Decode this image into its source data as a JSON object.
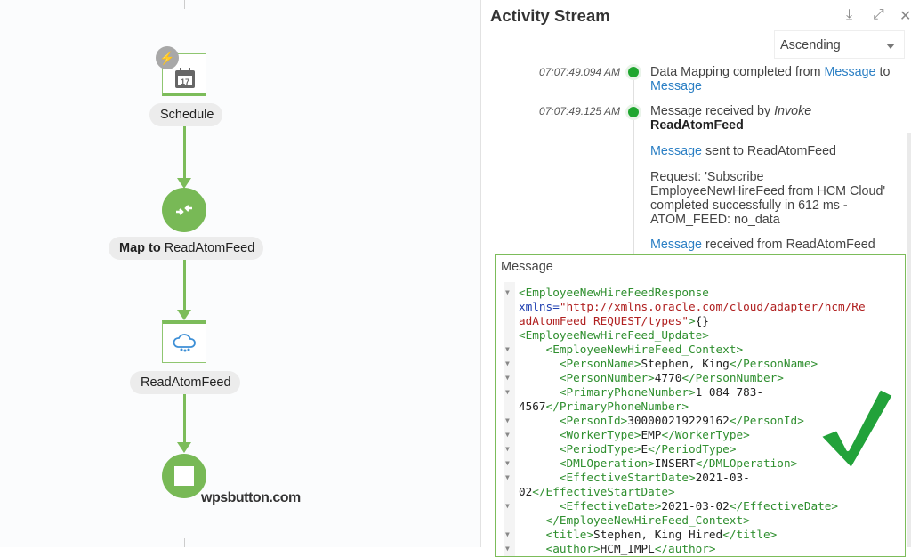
{
  "flow": {
    "nodes": [
      {
        "label": "Schedule",
        "icon": "calendar-icon",
        "day": "17",
        "badge": "lightning-icon"
      },
      {
        "label_bold": "Map to",
        "label": "ReadAtomFeed",
        "icon": "map-arrows-icon"
      },
      {
        "label": "ReadAtomFeed",
        "icon": "cloud-atom-icon"
      },
      {
        "icon": "stop-icon"
      }
    ],
    "accent": "#78b956",
    "watermark": "wpsbutton.com"
  },
  "panel": {
    "title": "Activity Stream",
    "icons": [
      "download-icon",
      "expand-icon",
      "close-icon"
    ],
    "sort": "Ascending",
    "events": [
      {
        "time": "07:07:49.094 AM",
        "t1": "Data Mapping completed from ",
        "l1": "Message",
        "t2": " to",
        "l2": "Message"
      },
      {
        "time": "07:07:49.125 AM",
        "t1": "Message received by ",
        "italic": "Invoke",
        "bold": "ReadAtomFeed",
        "sent_link": "Message",
        "sent_text": " sent to ReadAtomFeed",
        "request": "Request: 'Subscribe EmployeeNewHireFeed from HCM Cloud' completed successfully in 612 ms - ATOM_FEED: no_data",
        "recv_link": "Message",
        "recv_text": " received from ReadAtomFeed"
      }
    ],
    "status_color": "#1fa62f",
    "message": {
      "title": "Message",
      "lines": [
        {
          "fold": true,
          "parts": [
            [
              "tag",
              "<EmployeeNewHireFeedResponse"
            ]
          ]
        },
        {
          "fold": false,
          "parts": [
            [
              "attr",
              "xmlns="
            ],
            [
              "val",
              "\"http://xmlns.oracle.com/cloud/adapter/hcm/Re"
            ]
          ]
        },
        {
          "fold": false,
          "parts": [
            [
              "val",
              "adAtomFeed_REQUEST/types\""
            ],
            [
              "tag",
              ">"
            ],
            [
              "txt",
              "{}"
            ]
          ]
        },
        {
          "fold": false,
          "parts": [
            [
              "tag",
              "<EmployeeNewHireFeed_Update>"
            ]
          ]
        },
        {
          "fold": true,
          "parts": [
            [
              "txt",
              "    "
            ],
            [
              "tag",
              "<EmployeeNewHireFeed_Context>"
            ]
          ]
        },
        {
          "fold": true,
          "parts": [
            [
              "txt",
              "      "
            ],
            [
              "tag",
              "<PersonName>"
            ],
            [
              "txt",
              "Stephen, King"
            ],
            [
              "tag",
              "</PersonName>"
            ]
          ]
        },
        {
          "fold": true,
          "parts": [
            [
              "txt",
              "      "
            ],
            [
              "tag",
              "<PersonNumber>"
            ],
            [
              "txt",
              "4770"
            ],
            [
              "tag",
              "</PersonNumber>"
            ]
          ]
        },
        {
          "fold": true,
          "parts": [
            [
              "txt",
              "      "
            ],
            [
              "tag",
              "<PrimaryPhoneNumber>"
            ],
            [
              "txt",
              "1 084 783-"
            ]
          ]
        },
        {
          "fold": false,
          "parts": [
            [
              "txt",
              "4567"
            ],
            [
              "tag",
              "</PrimaryPhoneNumber>"
            ]
          ]
        },
        {
          "fold": true,
          "parts": [
            [
              "txt",
              "      "
            ],
            [
              "tag",
              "<PersonId>"
            ],
            [
              "txt",
              "300000219229162"
            ],
            [
              "tag",
              "</PersonId>"
            ]
          ]
        },
        {
          "fold": true,
          "parts": [
            [
              "txt",
              "      "
            ],
            [
              "tag",
              "<WorkerType>"
            ],
            [
              "txt",
              "EMP"
            ],
            [
              "tag",
              "</WorkerType>"
            ]
          ]
        },
        {
          "fold": true,
          "parts": [
            [
              "txt",
              "      "
            ],
            [
              "tag",
              "<PeriodType>"
            ],
            [
              "txt",
              "E"
            ],
            [
              "tag",
              "</PeriodType>"
            ]
          ]
        },
        {
          "fold": true,
          "parts": [
            [
              "txt",
              "      "
            ],
            [
              "tag",
              "<DMLOperation>"
            ],
            [
              "txt",
              "INSERT"
            ],
            [
              "tag",
              "</DMLOperation>"
            ]
          ]
        },
        {
          "fold": true,
          "parts": [
            [
              "txt",
              "      "
            ],
            [
              "tag",
              "<EffectiveStartDate>"
            ],
            [
              "txt",
              "2021-03-"
            ]
          ]
        },
        {
          "fold": false,
          "parts": [
            [
              "txt",
              "02"
            ],
            [
              "tag",
              "</EffectiveStartDate>"
            ]
          ]
        },
        {
          "fold": true,
          "parts": [
            [
              "txt",
              "      "
            ],
            [
              "tag",
              "<EffectiveDate>"
            ],
            [
              "txt",
              "2021-03-02"
            ],
            [
              "tag",
              "</EffectiveDate>"
            ]
          ]
        },
        {
          "fold": false,
          "parts": [
            [
              "txt",
              "    "
            ],
            [
              "tag",
              "</EmployeeNewHireFeed_Context>"
            ]
          ]
        },
        {
          "fold": true,
          "parts": [
            [
              "txt",
              "    "
            ],
            [
              "tag",
              "<title>"
            ],
            [
              "txt",
              "Stephen, King Hired"
            ],
            [
              "tag",
              "</title>"
            ]
          ]
        },
        {
          "fold": true,
          "parts": [
            [
              "txt",
              "    "
            ],
            [
              "tag",
              "<author>"
            ],
            [
              "txt",
              "HCM_IMPL"
            ],
            [
              "tag",
              "</author>"
            ]
          ]
        }
      ]
    }
  }
}
